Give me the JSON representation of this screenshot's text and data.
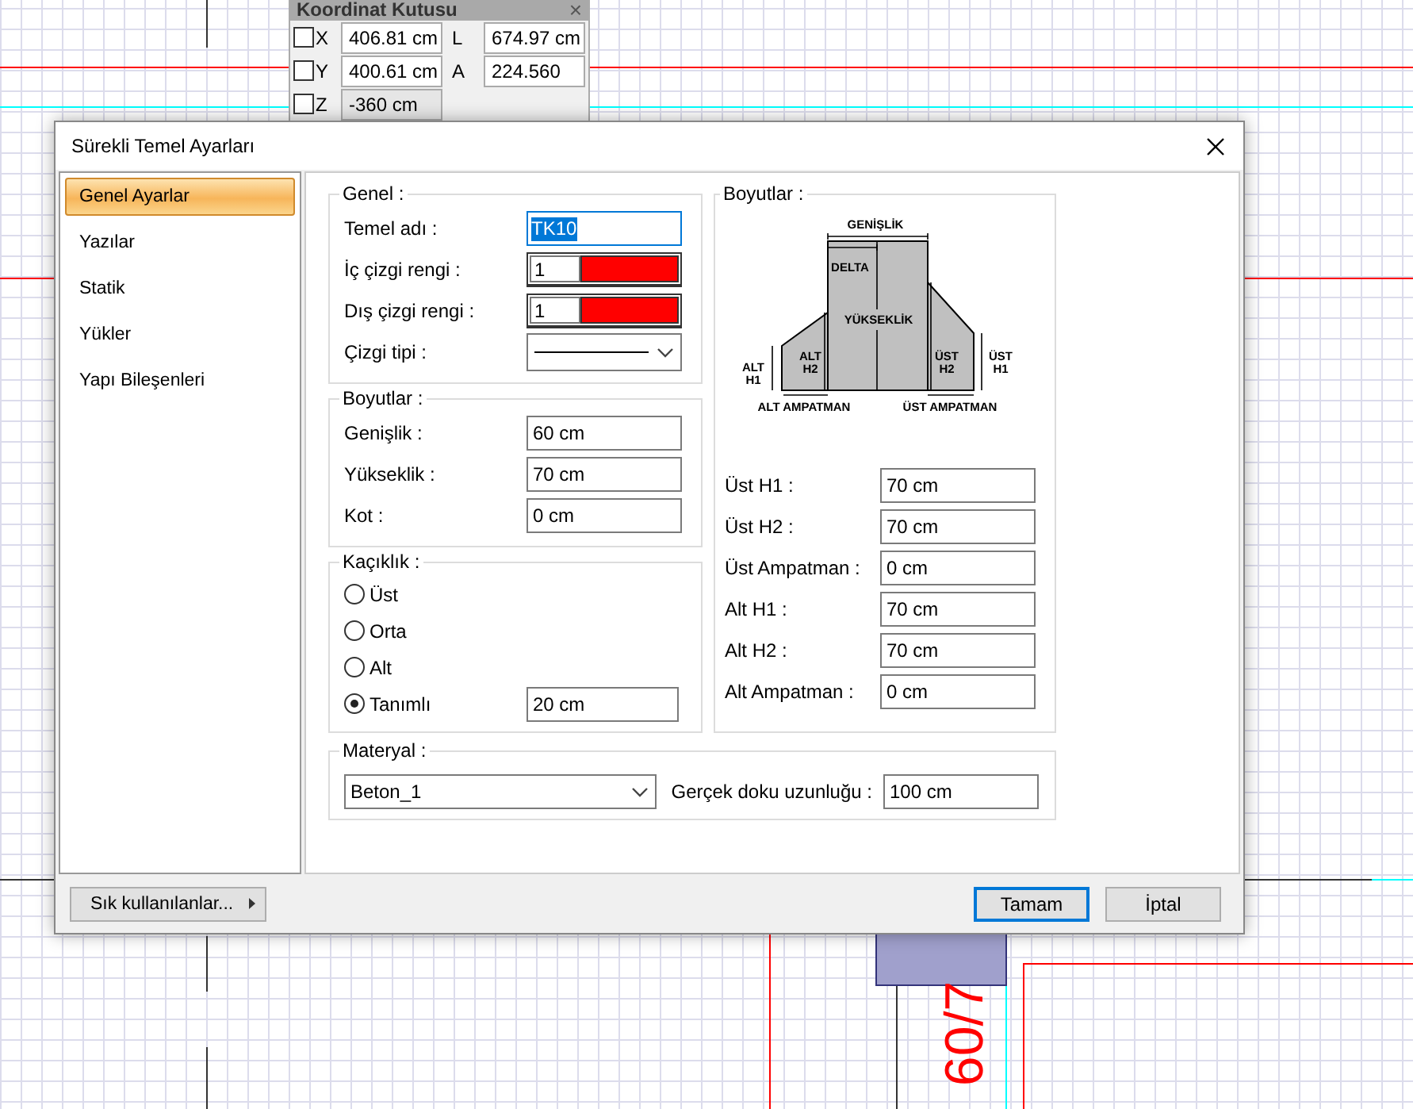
{
  "canvas": {
    "dimension_text": "60/7"
  },
  "coordinate_box": {
    "title": "Koordinat Kutusu",
    "close": "×",
    "rows": [
      {
        "axis": "X",
        "checked": false,
        "value": "406.81 cm",
        "label": "L",
        "value2": "674.97 cm",
        "disabled": false
      },
      {
        "axis": "Y",
        "checked": false,
        "value": "400.61 cm",
        "label": "A",
        "value2": "224.560",
        "disabled": false
      },
      {
        "axis": "Z",
        "checked": false,
        "value": "-360 cm",
        "disabled": true
      }
    ]
  },
  "dialog": {
    "title": "Sürekli Temel Ayarları",
    "sidebar": {
      "items": [
        {
          "label": "Genel Ayarlar",
          "selected": true
        },
        {
          "label": "Yazılar",
          "selected": false
        },
        {
          "label": "Statik",
          "selected": false
        },
        {
          "label": "Yükler",
          "selected": false
        },
        {
          "label": "Yapı Bileşenleri",
          "selected": false
        }
      ]
    },
    "genel": {
      "title": "Genel :",
      "name_label": "Temel adı :",
      "name_value": "TK10",
      "colors": [
        {
          "label": "İç çizgi rengi :",
          "value": "1",
          "color": "#ff0000"
        },
        {
          "label": "Dış çizgi rengi :",
          "value": "1",
          "color": "#ff0000"
        }
      ],
      "line_type_label": "Çizgi tipi :"
    },
    "boyutlar": {
      "title": "Boyutlar :",
      "fields": [
        {
          "label": "Genişlik :",
          "value": "60 cm"
        },
        {
          "label": "Yükseklik :",
          "value": "70 cm"
        },
        {
          "label": "Kot :",
          "value": "0 cm"
        }
      ]
    },
    "kaciklik": {
      "title": "Kaçıklık :",
      "options": [
        {
          "label": "Üst",
          "selected": false
        },
        {
          "label": "Orta",
          "selected": false
        },
        {
          "label": "Alt",
          "selected": false
        },
        {
          "label": "Tanımlı",
          "selected": true,
          "value": "20 cm"
        }
      ]
    },
    "diagram_group": {
      "title": "Boyutlar :",
      "labels": [
        {
          "lines": [
            "GENİŞLİK"
          ]
        },
        {
          "lines": [
            "DELTA"
          ]
        },
        {
          "lines": [
            "YÜKSEKLİK"
          ]
        },
        {
          "lines": [
            "ALT",
            "H2"
          ]
        },
        {
          "lines": [
            "ÜST",
            "H2"
          ]
        },
        {
          "lines": [
            "ALT",
            "H1"
          ]
        },
        {
          "lines": [
            "ÜST",
            "H1"
          ]
        },
        {
          "lines": [
            "ALT AMPATMAN"
          ]
        },
        {
          "lines": [
            "ÜST AMPATMAN"
          ]
        }
      ],
      "fields": [
        {
          "label": "Üst H1 :",
          "value": "70 cm"
        },
        {
          "label": "Üst H2 :",
          "value": "70 cm"
        },
        {
          "label": "Üst Ampatman :",
          "value": "0 cm"
        },
        {
          "label": "Alt H1 :",
          "value": "70 cm"
        },
        {
          "label": "Alt H2 :",
          "value": "70 cm"
        },
        {
          "label": "Alt Ampatman :",
          "value": "0 cm"
        }
      ]
    },
    "materyal": {
      "title": "Materyal :",
      "value": "Beton_1",
      "texture_label": "Gerçek doku uzunluğu :",
      "texture_value": "100 cm"
    },
    "favorites_button": "Sık kullanılanlar...",
    "buttons": [
      {
        "label": "Tamam",
        "default": true
      },
      {
        "label": "İptal",
        "default": false
      }
    ]
  }
}
